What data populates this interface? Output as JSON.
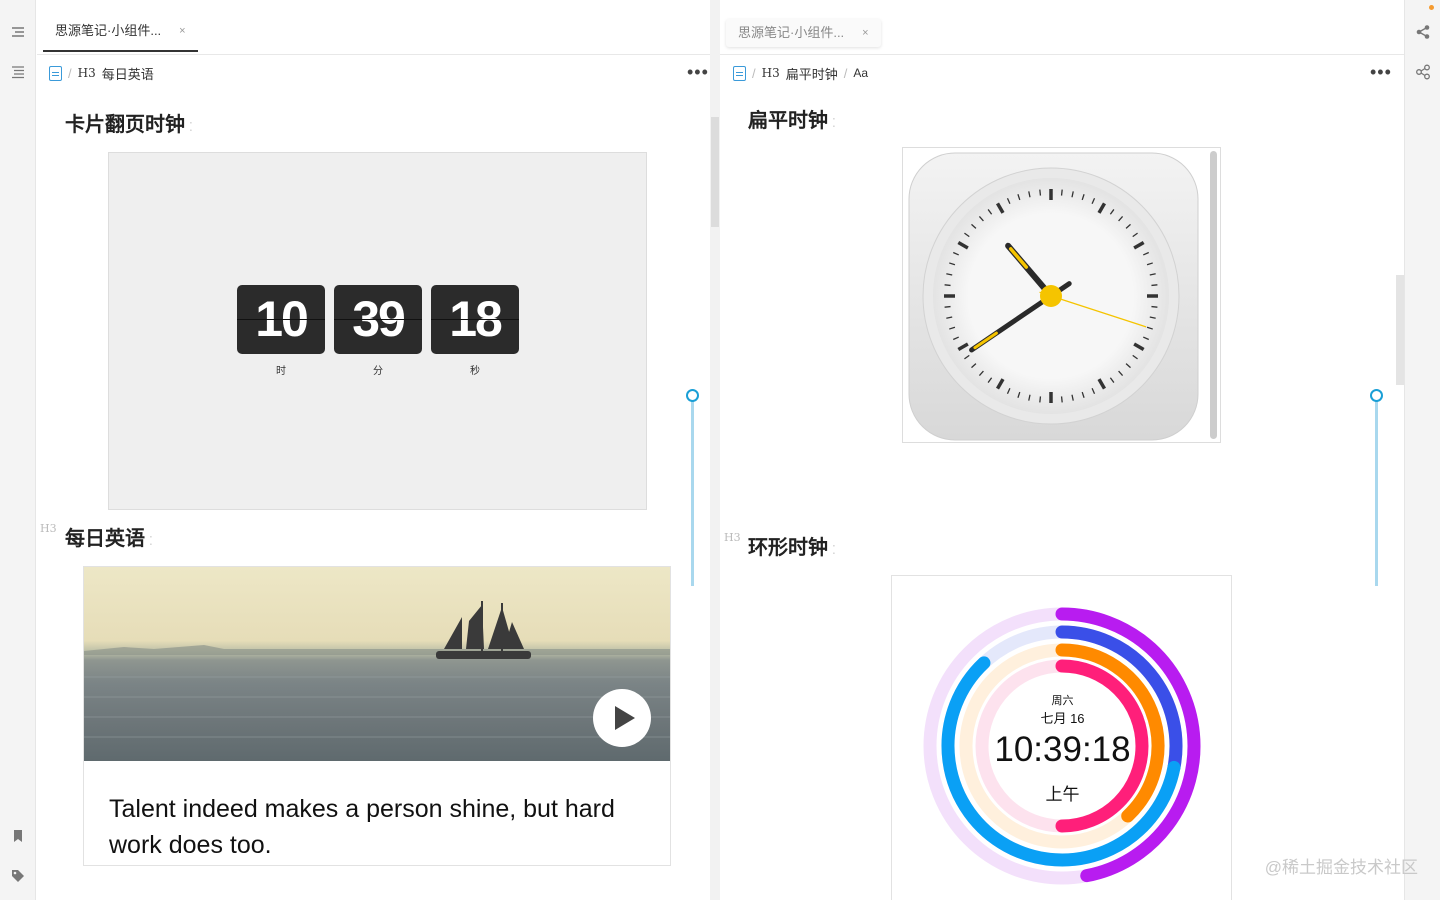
{
  "tabs": {
    "left": {
      "label": "思源笔记·小组件...",
      "close": "×"
    },
    "right": {
      "label": "思源笔记·小组件...",
      "close": "×"
    }
  },
  "left_pane": {
    "breadcrumb": {
      "sep": "/",
      "h3": "H3",
      "title": "每日英语"
    },
    "more": "•••",
    "heading1": "卡片翻页时钟",
    "flip_clock": {
      "hours": "10",
      "minutes": "39",
      "seconds": "18",
      "hours_label": "时",
      "minutes_label": "分",
      "seconds_label": "秒"
    },
    "heading_tag": "H3",
    "heading2": "每日英语",
    "quote": "Talent indeed makes a person shine, but hard work does too."
  },
  "right_pane": {
    "breadcrumb": {
      "sep": "/",
      "h3": "H3",
      "title": "扁平时钟",
      "sep2": "/",
      "extra": "Aa"
    },
    "more": "•••",
    "heading1": "扁平时钟",
    "heading_tag": "H3",
    "heading2": "环形时钟",
    "ring_clock": {
      "weekday": "周六",
      "date": "七月 16",
      "time": "10:39:18",
      "ampm": "上午"
    }
  },
  "analog_clock": {
    "hour": 10,
    "minute": 39,
    "second": 18
  },
  "watermark": "@稀土掘金技术社区",
  "colors": {
    "accent": "#1a9fd6",
    "hand_yellow": "#f5c400",
    "ring_purple": "#b81cf0",
    "ring_blue": "#3a4fe8",
    "ring_orange": "#ff8a00",
    "ring_pink": "#ff1f7a",
    "ring_sky": "#0aa0f5"
  }
}
